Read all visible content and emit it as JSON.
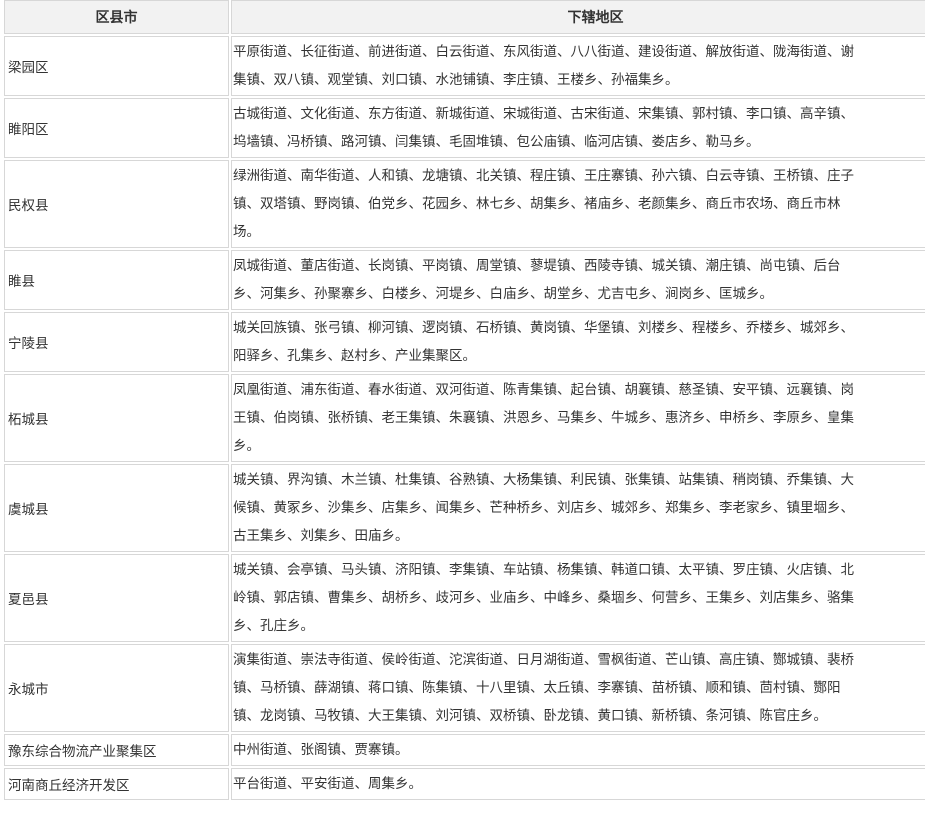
{
  "table": {
    "headers": [
      "区县市",
      "下辖地区"
    ],
    "rows": [
      {
        "name": "梁园区",
        "lines": [
          "平原街道、长征街道、前进街道、白云街道、东风街道、八八街道、建设街道、解放街道、陇海街道、谢",
          "集镇、双八镇、观堂镇、刘口镇、水池铺镇、李庄镇、王楼乡、孙福集乡。"
        ]
      },
      {
        "name": "睢阳区",
        "lines": [
          "古城街道、文化街道、东方街道、新城街道、宋城街道、古宋街道、宋集镇、郭村镇、李口镇、高辛镇、",
          "坞墙镇、冯桥镇、路河镇、闫集镇、毛固堆镇、包公庙镇、临河店镇、娄店乡、勒马乡。"
        ]
      },
      {
        "name": "民权县",
        "lines": [
          "绿洲街道、南华街道、人和镇、龙塘镇、北关镇、程庄镇、王庄寨镇、孙六镇、白云寺镇、王桥镇、庄子",
          "镇、双塔镇、野岗镇、伯党乡、花园乡、林七乡、胡集乡、褚庙乡、老颜集乡、商丘市农场、商丘市林",
          "场。"
        ]
      },
      {
        "name": "睢县",
        "lines": [
          "凤城街道、董店街道、长岗镇、平岗镇、周堂镇、蓼堤镇、西陵寺镇、城关镇、潮庄镇、尚屯镇、后台",
          "乡、河集乡、孙聚寨乡、白楼乡、河堤乡、白庙乡、胡堂乡、尤吉屯乡、涧岗乡、匡城乡。"
        ]
      },
      {
        "name": "宁陵县",
        "lines": [
          "城关回族镇、张弓镇、柳河镇、逻岗镇、石桥镇、黄岗镇、华堡镇、刘楼乡、程楼乡、乔楼乡、城郊乡、",
          "阳驿乡、孔集乡、赵村乡、产业集聚区。"
        ]
      },
      {
        "name": "柘城县",
        "lines": [
          "凤凰街道、浦东街道、春水街道、双河街道、陈青集镇、起台镇、胡襄镇、慈圣镇、安平镇、远襄镇、岗",
          "王镇、伯岗镇、张桥镇、老王集镇、朱襄镇、洪恩乡、马集乡、牛城乡、惠济乡、申桥乡、李原乡、皇集",
          "乡。"
        ]
      },
      {
        "name": "虞城县",
        "lines": [
          "城关镇、界沟镇、木兰镇、杜集镇、谷熟镇、大杨集镇、利民镇、张集镇、站集镇、稍岗镇、乔集镇、大",
          "候镇、黄冢乡、沙集乡、店集乡、闻集乡、芒种桥乡、刘店乡、城郊乡、郑集乡、李老家乡、镇里堌乡、",
          "古王集乡、刘集乡、田庙乡。"
        ]
      },
      {
        "name": "夏邑县",
        "lines": [
          "城关镇、会亭镇、马头镇、济阳镇、李集镇、车站镇、杨集镇、韩道口镇、太平镇、罗庄镇、火店镇、北",
          "岭镇、郭店镇、曹集乡、胡桥乡、歧河乡、业庙乡、中峰乡、桑堌乡、何营乡、王集乡、刘店集乡、骆集",
          "乡、孔庄乡。"
        ]
      },
      {
        "name": "永城市",
        "lines": [
          "演集街道、崇法寺街道、侯岭街道、沱滨街道、日月湖街道、雪枫街道、芒山镇、高庄镇、酂城镇、裴桥",
          "镇、马桥镇、薛湖镇、蒋口镇、陈集镇、十八里镇、太丘镇、李寨镇、苗桥镇、顺和镇、茴村镇、酂阳",
          "镇、龙岗镇、马牧镇、大王集镇、刘河镇、双桥镇、卧龙镇、黄口镇、新桥镇、条河镇、陈官庄乡。"
        ]
      },
      {
        "name": "豫东综合物流产业聚集区",
        "lines": [
          "中州街道、张阁镇、贾寨镇。"
        ]
      },
      {
        "name": "河南商丘经济开发区",
        "lines": [
          "平台街道、平安街道、周集乡。"
        ]
      }
    ]
  }
}
